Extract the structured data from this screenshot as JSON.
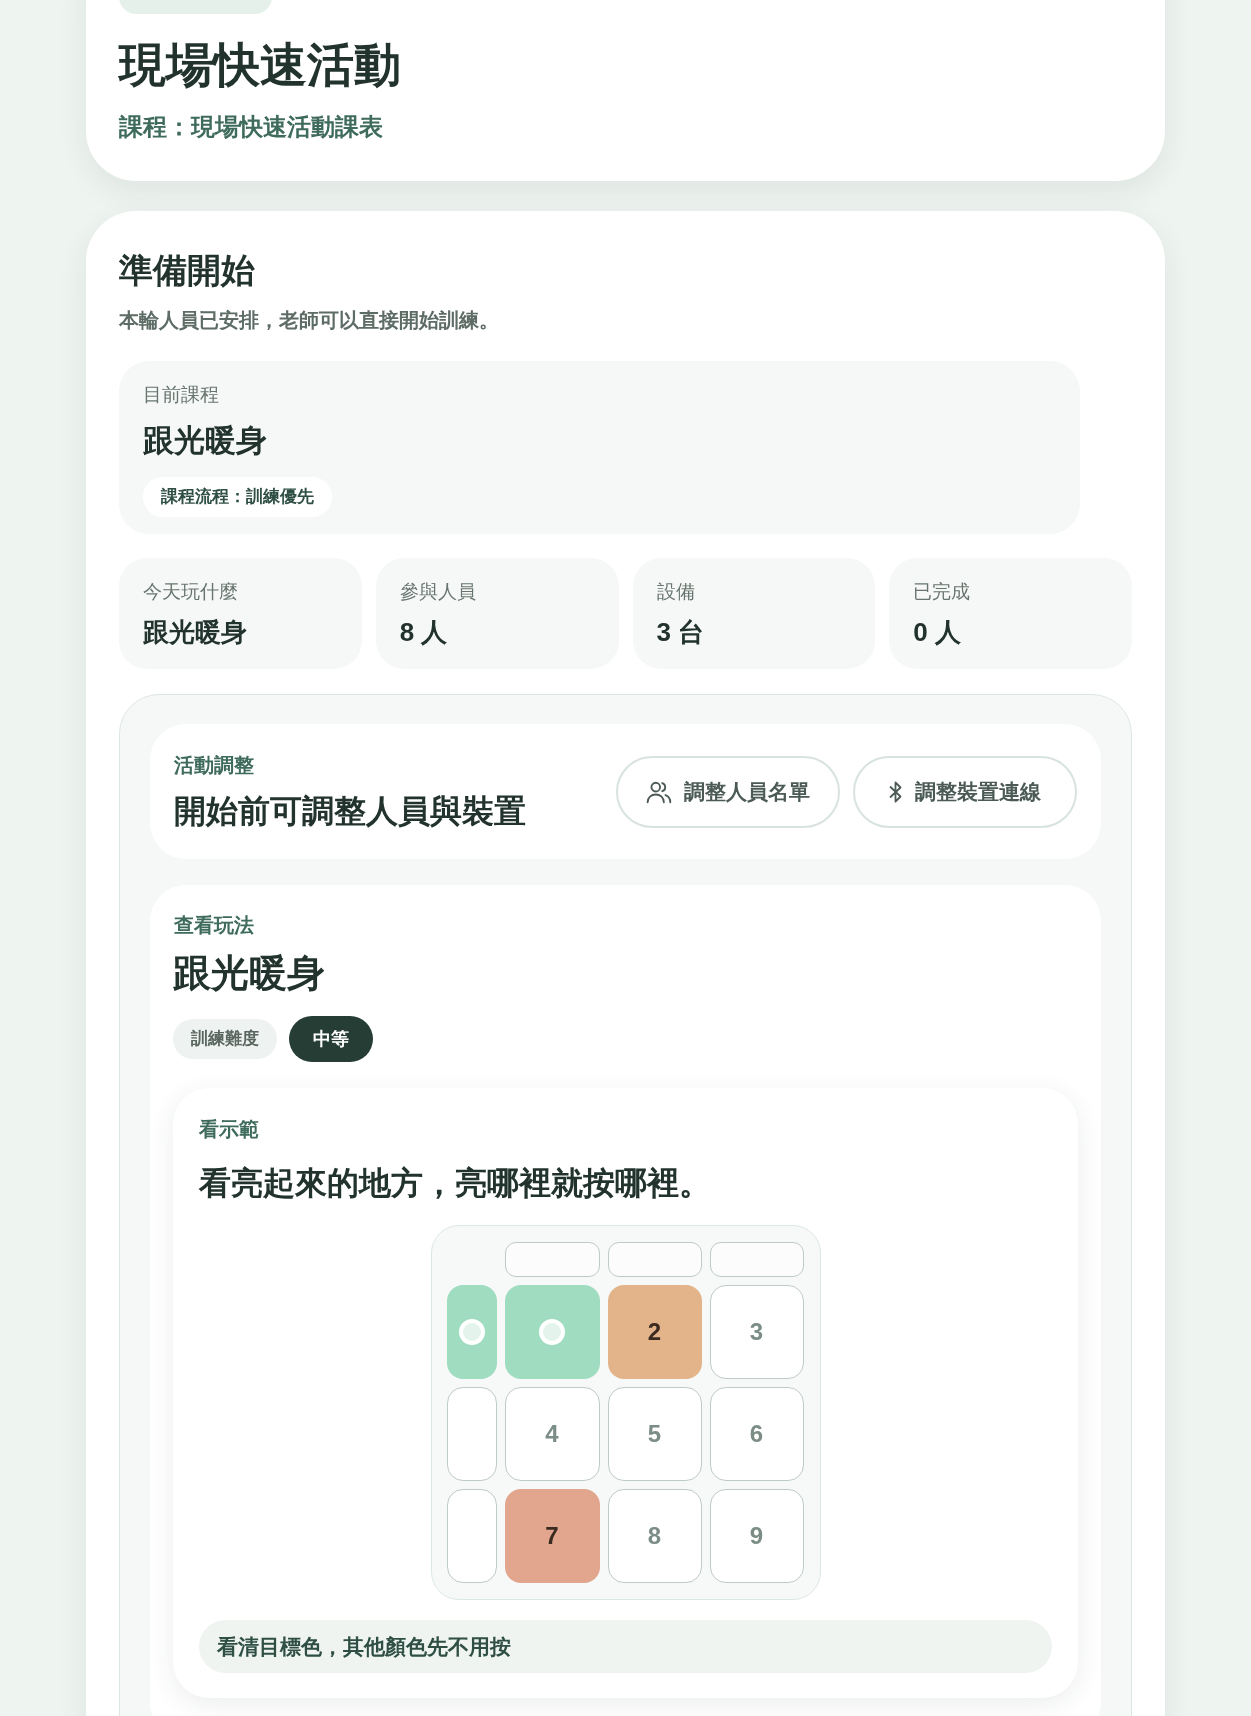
{
  "header": {
    "title": "現場快速活動",
    "subtitle": "課程：現場快速活動課表"
  },
  "ready": {
    "title": "準備開始",
    "description": "本輪人員已安排，老師可以直接開始訓練。",
    "current_course": {
      "label": "目前課程",
      "name": "跟光暖身",
      "flow": "課程流程：訓練優先"
    },
    "stats": [
      {
        "label": "今天玩什麼",
        "value": "跟光暖身"
      },
      {
        "label": "參與人員",
        "value": "8 人"
      },
      {
        "label": "設備",
        "value": "3 台"
      },
      {
        "label": "已完成",
        "value": "0 人"
      }
    ]
  },
  "adjust": {
    "label": "活動調整",
    "title": "開始前可調整人員與裝置",
    "buttons": [
      {
        "kind": "people",
        "label": "調整人員名單"
      },
      {
        "kind": "bluetooth",
        "label": "調整裝置連線"
      }
    ]
  },
  "gameplay": {
    "label": "查看玩法",
    "title": "跟光暖身",
    "difficulty": {
      "label": "訓練難度",
      "value": "中等"
    },
    "demo": {
      "label": "看示範",
      "instruction": "看亮起來的地方，亮哪裡就按哪裡。",
      "pad_grid": {
        "rows": [
          {
            "side": {
              "kind": "target",
              "color": "#a0dcc0"
            },
            "pads": [
              {
                "kind": "target",
                "color": "#a0dcc0"
              },
              {
                "kind": "lit",
                "label": "2",
                "color": "#e3b48a"
              },
              {
                "kind": "off",
                "label": "3"
              }
            ]
          },
          {
            "side": {
              "kind": "off"
            },
            "pads": [
              {
                "kind": "off",
                "label": "4"
              },
              {
                "kind": "off",
                "label": "5"
              },
              {
                "kind": "off",
                "label": "6"
              }
            ]
          },
          {
            "side": {
              "kind": "off"
            },
            "pads": [
              {
                "kind": "lit",
                "label": "7",
                "color": "#e2a58e"
              },
              {
                "kind": "off",
                "label": "8"
              },
              {
                "kind": "off",
                "label": "9"
              }
            ]
          }
        ]
      },
      "tip": "看清目標色，其他顏色先不用按"
    }
  }
}
